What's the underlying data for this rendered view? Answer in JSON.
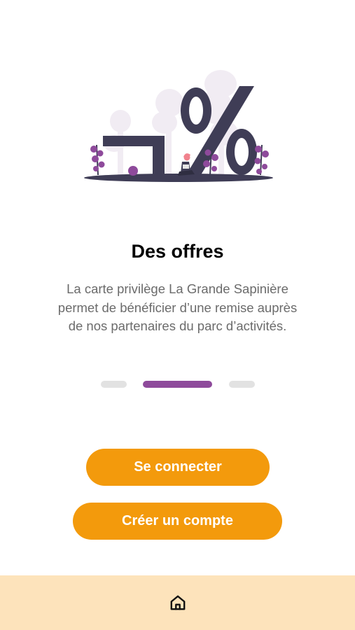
{
  "onboarding": {
    "illustration_icon": "discount-percent-illustration",
    "title": "Des offres",
    "description": "La carte privilège La Grande Sapinière permet de bénéficier d’une remise auprès de nos partenaires du parc d’activités.",
    "pagination": {
      "total": 3,
      "active": 2
    }
  },
  "actions": {
    "login_label": "Se connecter",
    "signup_label": "Créer un compte"
  },
  "bottom_nav": {
    "home_icon": "home-icon"
  },
  "colors": {
    "accent_orange": "#f39a0c",
    "active_dot_purple": "#8e4a9b",
    "inactive_dot_gray": "#e2e2e2",
    "bottom_bar_bg": "#fde3bb",
    "illustration_dark": "#3f3d56",
    "illustration_purple": "#8e4a9b"
  }
}
